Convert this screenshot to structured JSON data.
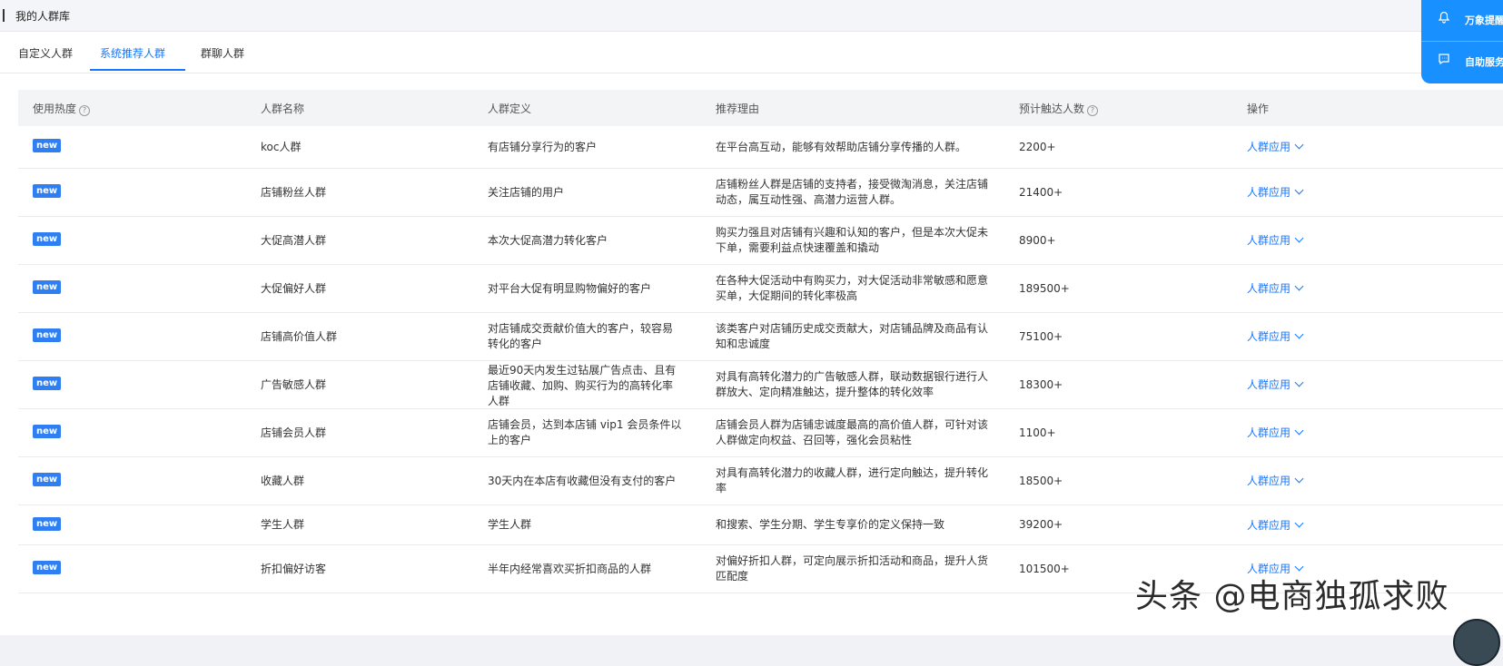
{
  "header": {
    "title": "我的人群库"
  },
  "tabs": [
    {
      "label": "自定义人群",
      "active": false
    },
    {
      "label": "系统推荐人群",
      "active": true
    },
    {
      "label": "群聊人群",
      "active": false
    }
  ],
  "table": {
    "columns": [
      "使用热度",
      "人群名称",
      "人群定义",
      "推荐理由",
      "预计触达人数",
      "操作"
    ],
    "help_icon": "?",
    "badge": "new",
    "action_label": "人群应用",
    "rows": [
      {
        "name": "koc人群",
        "definition": "有店铺分享行为的客户",
        "reason": "在平台高互动，能够有效帮助店铺分享传播的人群。",
        "reach": "2200+"
      },
      {
        "name": "店铺粉丝人群",
        "definition": "关注店铺的用户",
        "reason": "店铺粉丝人群是店铺的支持者，接受微淘消息，关注店铺动态，属互动性强、高潜力运营人群。",
        "reach": "21400+"
      },
      {
        "name": "大促高潜人群",
        "definition": "本次大促高潜力转化客户",
        "reason": "购买力强且对店铺有兴趣和认知的客户，但是本次大促未下单，需要利益点快速覆盖和撬动",
        "reach": "8900+"
      },
      {
        "name": "大促偏好人群",
        "definition": "对平台大促有明显购物偏好的客户",
        "reason": "在各种大促活动中有购买力，对大促活动非常敏感和愿意买单，大促期间的转化率极高",
        "reach": "189500+"
      },
      {
        "name": "店铺高价值人群",
        "definition": "对店铺成交贡献价值大的客户，较容易转化的客户",
        "reason": "该类客户对店铺历史成交贡献大，对店铺品牌及商品有认知和忠诚度",
        "reach": "75100+"
      },
      {
        "name": "广告敏感人群",
        "definition": "最近90天内发生过钻展广告点击、且有店铺收藏、加购、购买行为的高转化率人群",
        "reason": "对具有高转化潜力的广告敏感人群，联动数据银行进行人群放大、定向精准触达，提升整体的转化效率",
        "reach": "18300+"
      },
      {
        "name": "店铺会员人群",
        "definition": "店铺会员，达到本店铺 vip1 会员条件以上的客户",
        "reason": "店铺会员人群为店铺忠诚度最高的高价值人群，可针对该人群做定向权益、召回等，强化会员粘性",
        "reach": "1100+"
      },
      {
        "name": "收藏人群",
        "definition": "30天内在本店有收藏但没有支付的客户",
        "reason": "对具有高转化潜力的收藏人群，进行定向触达，提升转化率",
        "reach": "18500+"
      },
      {
        "name": "学生人群",
        "definition": "学生人群",
        "reason": "和搜索、学生分期、学生专享价的定义保持一致",
        "reach": "39200+"
      },
      {
        "name": "折扣偏好访客",
        "definition": "半年内经常喜欢买折扣商品的人群",
        "reason": "对偏好折扣人群，可定向展示折扣活动和商品，提升人货匹配度",
        "reach": "101500+"
      }
    ]
  },
  "float_panel": {
    "items": [
      {
        "label": "万象提醒",
        "icon": "bell-icon"
      },
      {
        "label": "自助服务",
        "icon": "chat-icon"
      }
    ]
  },
  "watermark": "头条 @电商独孤求败",
  "colors": {
    "accent": "#1677ff",
    "badge": "#2f7ff2",
    "float": "#1890ff"
  }
}
